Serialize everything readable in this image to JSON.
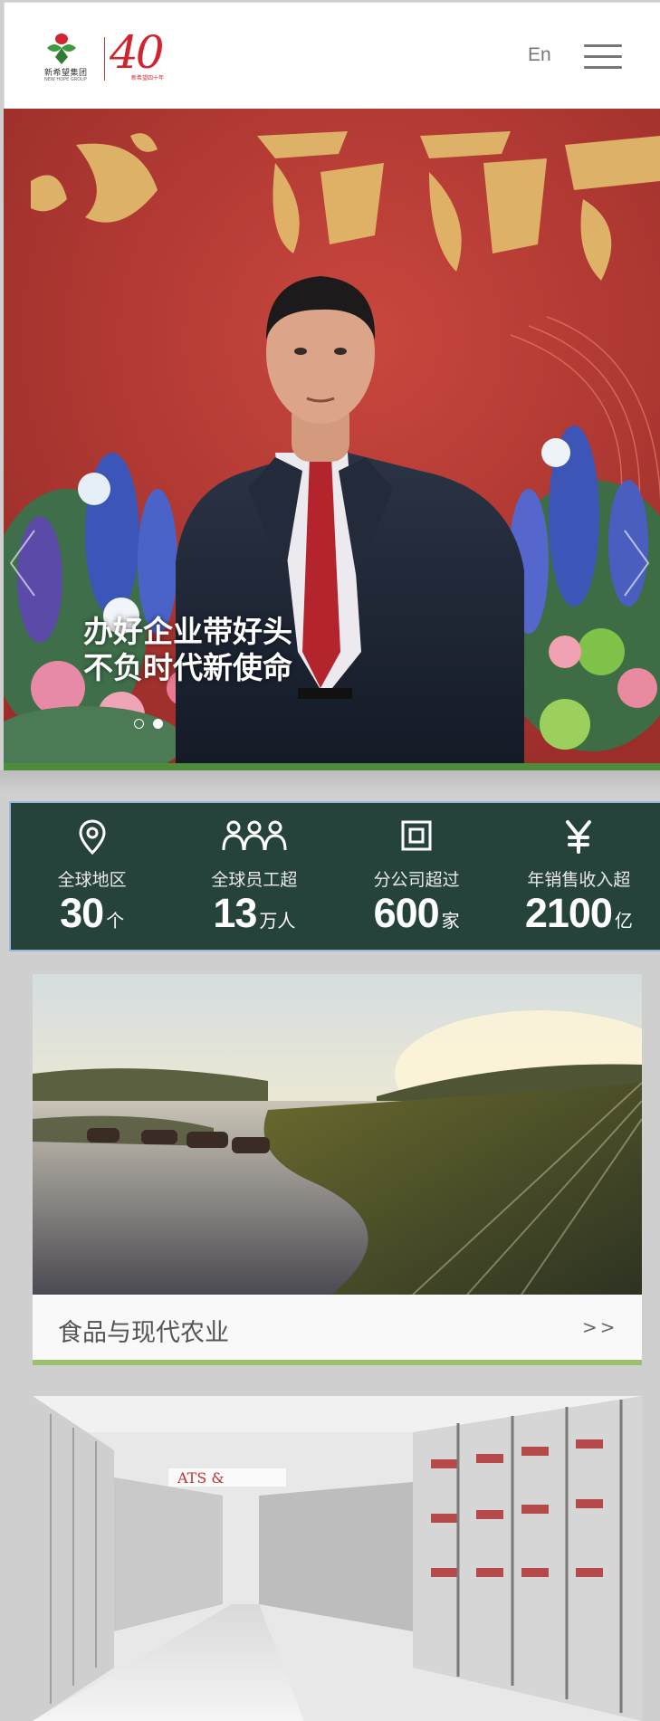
{
  "header": {
    "logo_text": "新希望集团",
    "logo_sub": "NEW HOPE GROUP",
    "anniversary_number": "40",
    "anniversary_sub": "新希望四十年",
    "lang_label": "En"
  },
  "banner": {
    "caption_line1": "办好企业带好头",
    "caption_line2": "不负时代新使命",
    "backdrop_text": "心  砥砺前",
    "slide_count": 2,
    "active_slide": 2
  },
  "stats": [
    {
      "icon": "location-pin-icon",
      "label": "全球地区",
      "value": "30",
      "unit": "个"
    },
    {
      "icon": "people-icon",
      "label": "全球员工超",
      "value": "13",
      "unit": "万人"
    },
    {
      "icon": "building-icon",
      "label": "分公司超过",
      "value": "600",
      "unit": "家"
    },
    {
      "icon": "yen-icon",
      "label": "年销售收入超",
      "value": "2100",
      "unit": "亿"
    }
  ],
  "cards": [
    {
      "title": "食品与现代农业",
      "more": ">>"
    },
    {
      "title": "",
      "more": ""
    }
  ],
  "colors": {
    "brand_red": "#d0242f",
    "stats_bg": "#25433b",
    "accent_green": "#9cc16c",
    "banner_green": "#4c8c3b"
  }
}
